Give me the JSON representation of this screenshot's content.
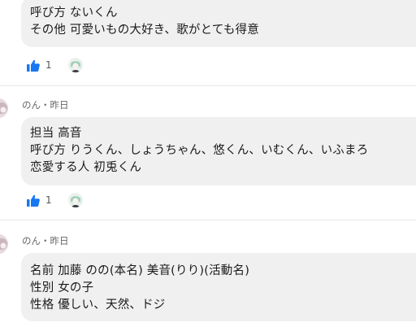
{
  "posts": [
    {
      "lines": [
        "呼び方 ないくん",
        "その他 可愛いもの大好き、歌がとても得意"
      ],
      "like_count": "1"
    },
    {
      "author": "のん",
      "time": "昨日",
      "lines": [
        "担当 高音",
        "呼び方 りうくん、しょうちゃん、悠くん、いむくん、いふまろ",
        "恋愛する人 初兎くん"
      ],
      "like_count": "1"
    },
    {
      "author": "のん",
      "time": "昨日",
      "lines": [
        "名前 加藤 のの(本名) 美音(りり)(活動名)",
        "性別 女の子",
        "性格 優しい、天然、ドジ"
      ]
    }
  ],
  "meta_separator": "・",
  "colors": {
    "like_blue": "#1877f2",
    "bubble_bg": "#f0f0f0"
  },
  "icons": {
    "like": "thumbs-up-icon"
  }
}
